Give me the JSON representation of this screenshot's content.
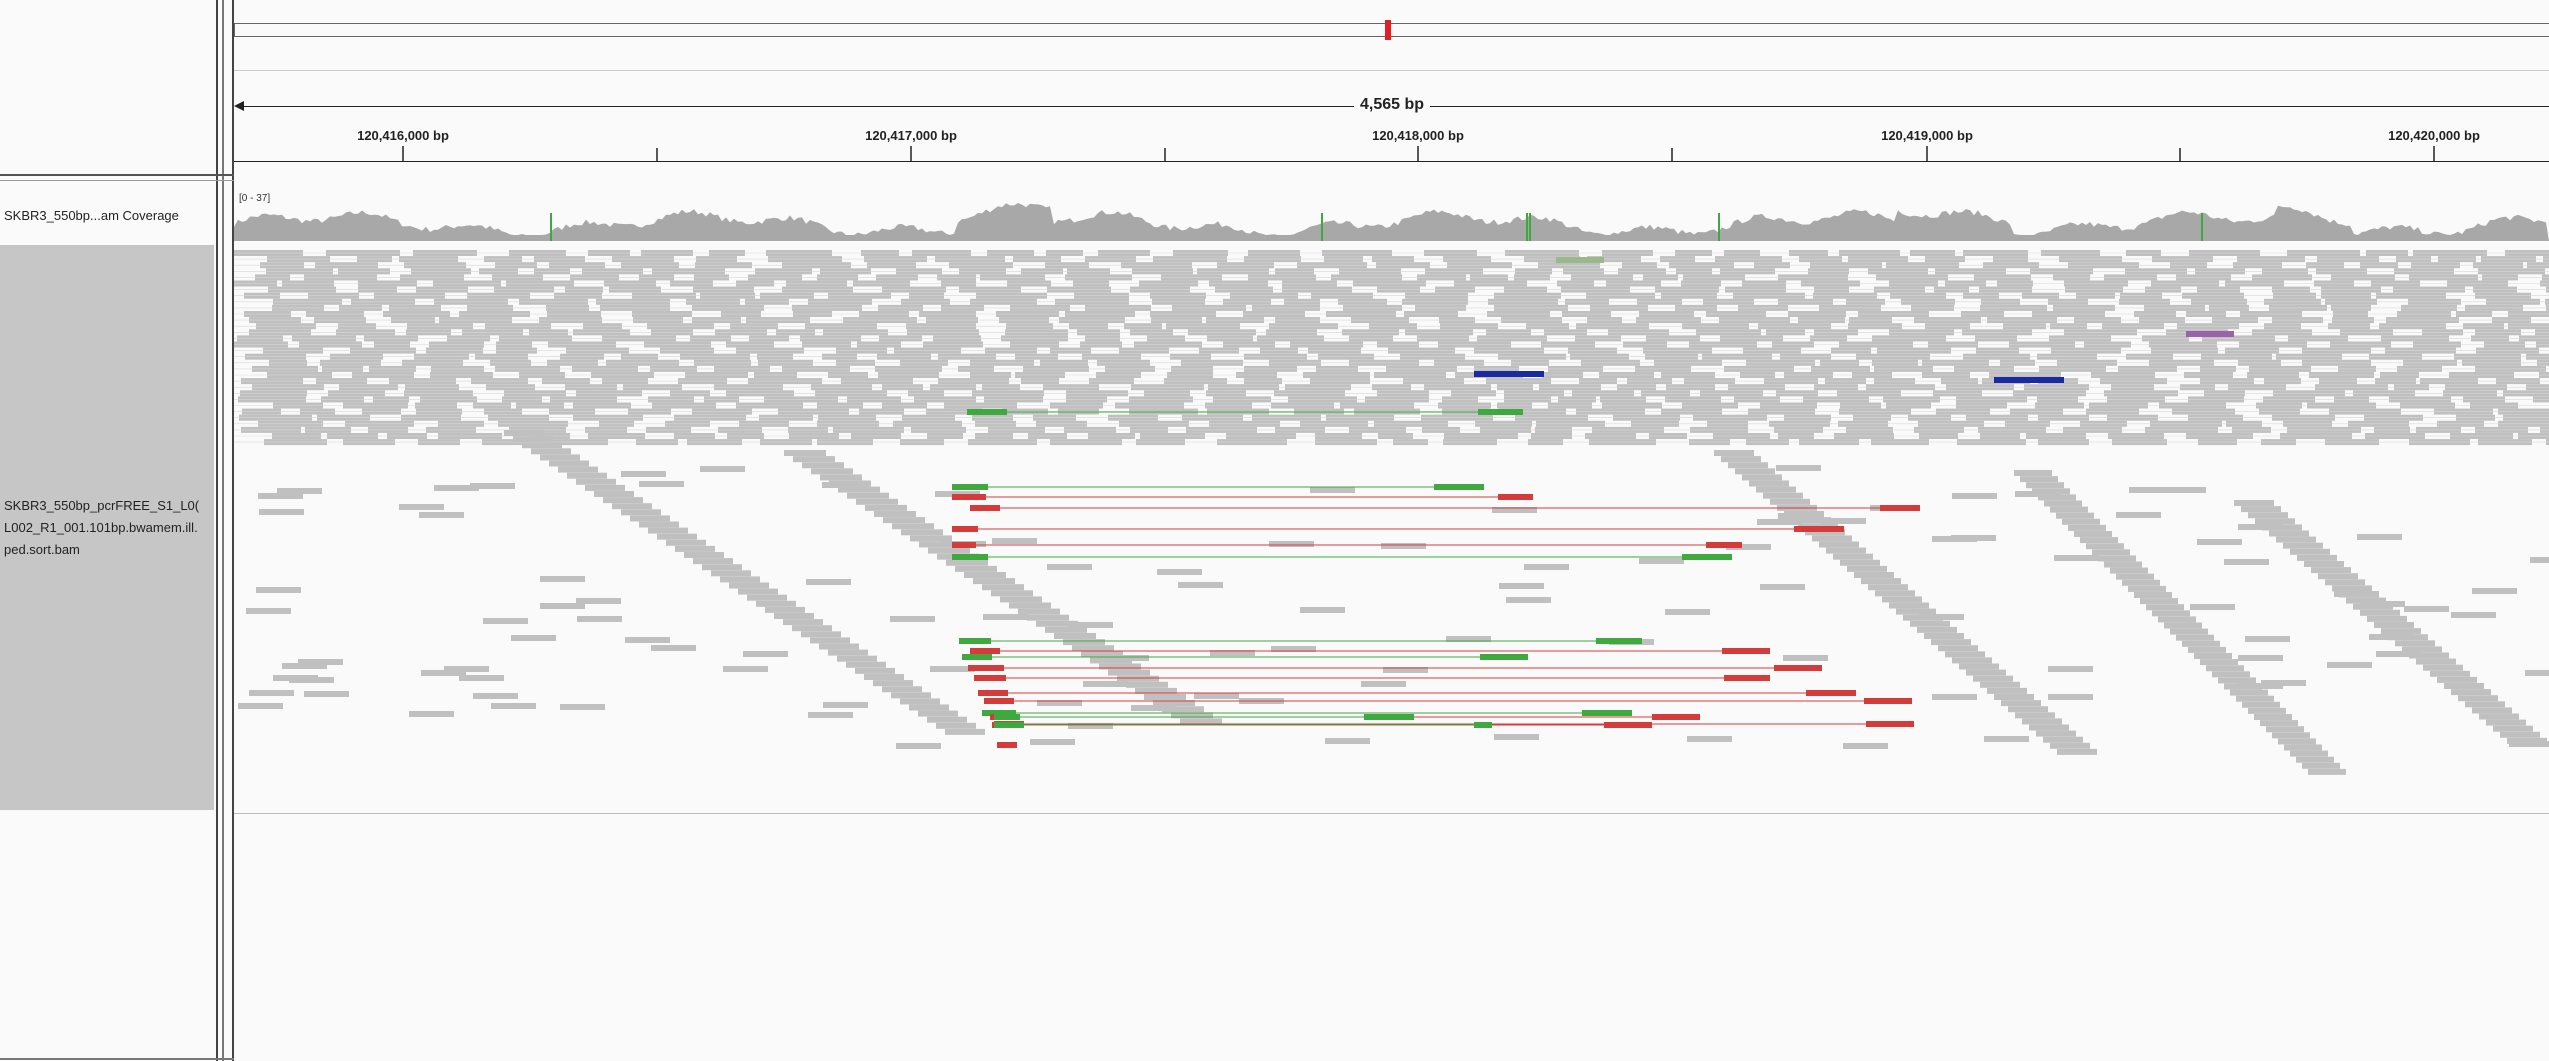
{
  "ruler": {
    "span_label": "4,565 bp",
    "ticks": [
      "120,416,000 bp",
      "120,417,000 bp",
      "120,418,000 bp",
      "120,419,000 bp",
      "120,420,000 bp"
    ]
  },
  "tracks": {
    "coverage": {
      "name": "SKBR3_550bp...am Coverage",
      "range_label": "[0 - 37]"
    },
    "alignment": {
      "name_lines": [
        "SKBR3_550bp_pcrFREE_S1_L0(",
        "L002_R1_001.101bp.bwamem.ill.",
        "ped.sort.bam"
      ]
    }
  },
  "colors": {
    "read": "#c0c0c0",
    "deletion_pair": "#d43c3c",
    "insertion_pair": "#3fa83f",
    "inversion_pair": "#1a2aa0",
    "translocation_pair": "#9a62a8",
    "locus_marker": "#e02020",
    "coverage": "#a8a8a8"
  }
}
